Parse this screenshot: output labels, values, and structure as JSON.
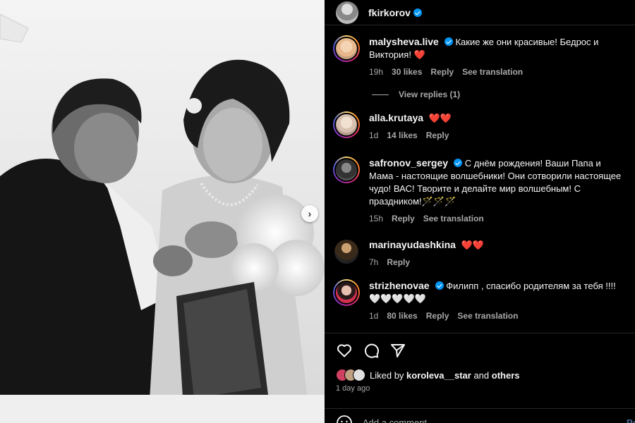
{
  "post": {
    "author": "fkirkorov",
    "photo_alt": "Black and white photo of a couple with flowers",
    "next_icon": "chevron-right-icon"
  },
  "comments": [
    {
      "user": "malysheva.live",
      "verified": true,
      "text": "Какие же они красивые! Бедрос и Виктория! ❤️",
      "time": "19h",
      "likes": "30 likes",
      "reply": "Reply",
      "translate": "See translation"
    },
    {
      "user": "alla.krutaya",
      "verified": false,
      "text": "❤️❤️",
      "time": "1d",
      "likes": "14 likes",
      "reply": "Reply"
    },
    {
      "user": "safronov_sergey",
      "verified": true,
      "text": "С днём рождения! Ваши Папа и Мама - настоящие волшебники! Они сотворили настоящее чудо! ВАС! Творите и делайте мир волшебным! С праздником!🪄🪄🪄",
      "time": "15h",
      "reply": "Reply",
      "translate": "See translation"
    },
    {
      "user": "marinayudashkina",
      "verified": false,
      "text": "❤️❤️",
      "time": "7h",
      "reply": "Reply"
    },
    {
      "user": "strizhenovae",
      "verified": true,
      "text": "Филипп , спасибо родителям за тебя !!!! 🤍🤍🤍🤍🤍",
      "time": "1d",
      "likes": "80 likes",
      "reply": "Reply",
      "translate": "See translation"
    }
  ],
  "view_replies": "View replies (1)",
  "actions": {
    "liked_prefix": "Liked by ",
    "liked_user": "koroleva__star",
    "liked_and": " and ",
    "liked_others": "others",
    "date": "1 day ago",
    "add_comment_placeholder": "Add a comment…",
    "post_label": "Post"
  },
  "colors": {
    "accent": "#0095f6",
    "muted": "#a8a8a8",
    "background": "#000000"
  }
}
